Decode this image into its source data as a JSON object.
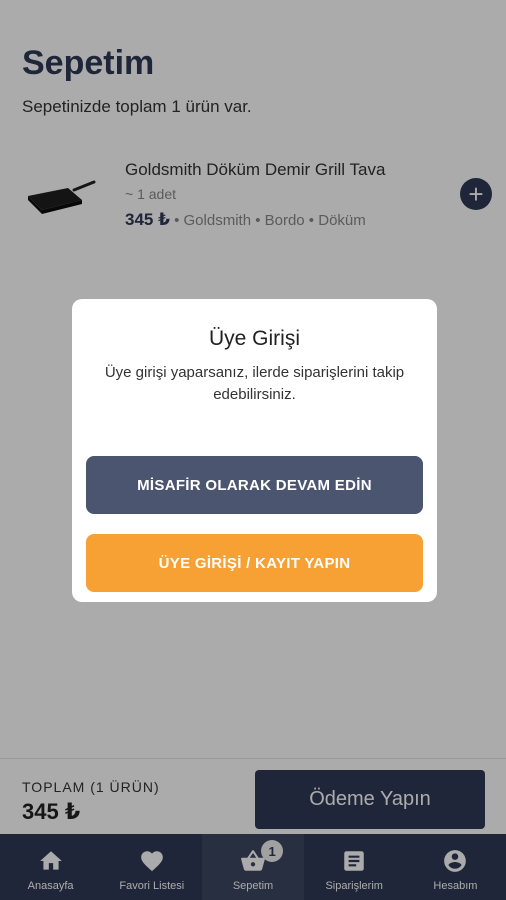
{
  "header": {
    "title": "Sepetim",
    "subtitle": "Sepetinizde toplam 1 ürün var."
  },
  "cart": {
    "items": [
      {
        "name": "Goldsmith Döküm Demir Grill Tava",
        "quantity": "~ 1 adet",
        "price": "345 ₺",
        "details": " • Goldsmith • Bordo • Döküm",
        "image": "grill-pan-icon"
      }
    ]
  },
  "summary": {
    "label": "TOPLAM (1 ÜRÜN)",
    "total": "345 ₺",
    "pay_button": "Ödeme Yapın"
  },
  "dialog": {
    "title": "Üye Girişi",
    "text": "Üye girişi yaparsanız, ilerde siparişlerini takip edebilirsiniz.",
    "guest_button": "MİSAFİR OLARAK DEVAM EDİN",
    "login_button": "ÜYE GİRİŞİ / KAYIT YAPIN"
  },
  "tabbar": {
    "tabs": [
      {
        "label": "Anasayfa",
        "icon": "home-icon"
      },
      {
        "label": "Favori Listesi",
        "icon": "heart-icon"
      },
      {
        "label": "Sepetim",
        "icon": "basket-icon",
        "badge": "1",
        "active": true
      },
      {
        "label": "Siparişlerim",
        "icon": "orders-icon"
      },
      {
        "label": "Hesabım",
        "icon": "account-icon"
      }
    ]
  },
  "colors": {
    "primary": "#2f3a56",
    "guest_button": "#4c5570",
    "accent": "#f7a135"
  }
}
